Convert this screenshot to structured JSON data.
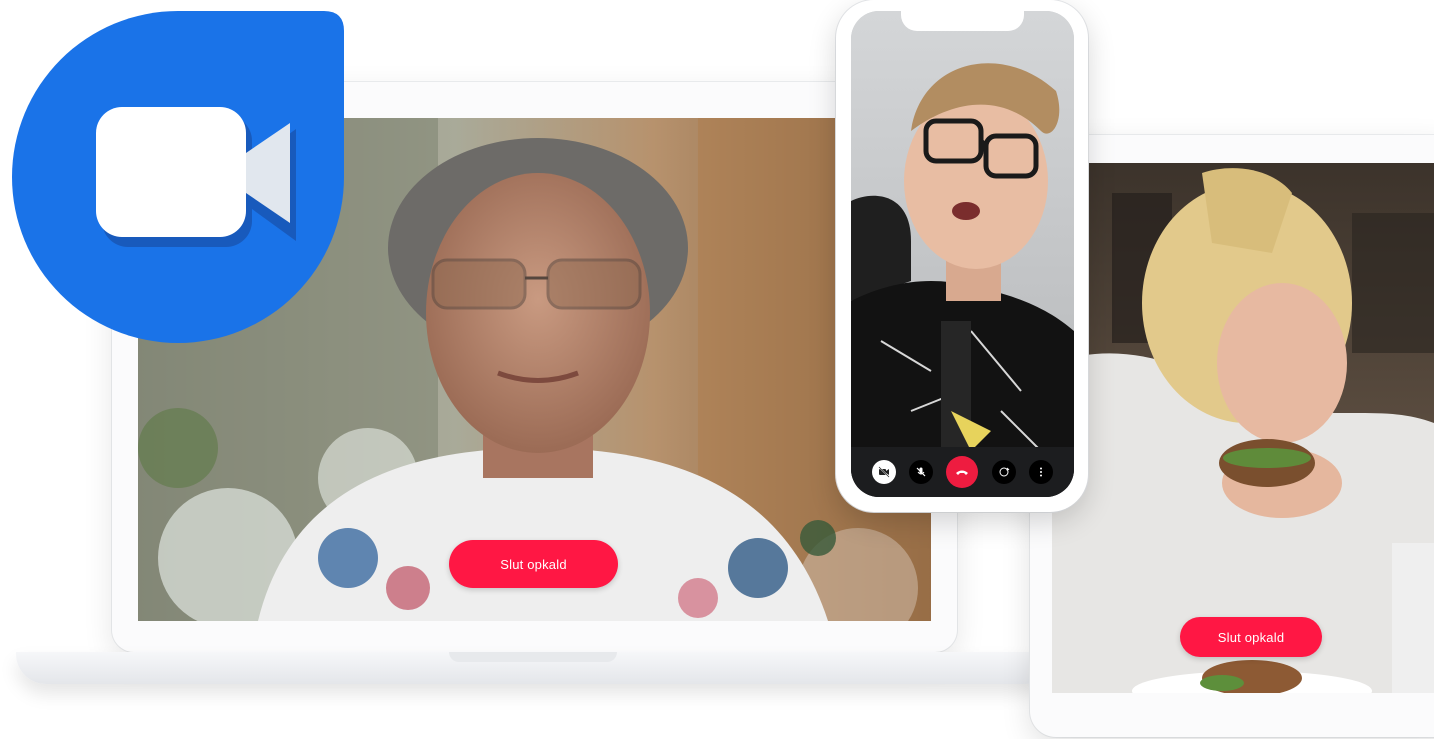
{
  "laptop": {
    "end_call_label": "Slut opkald"
  },
  "tablet": {
    "end_call_label": "Slut opkald"
  },
  "phone": {
    "controls": [
      "camera-off-icon",
      "mic-off-icon",
      "end-call-icon",
      "switch-camera-icon",
      "more-icon"
    ]
  },
  "logo": {
    "icon": "video-camera-icon"
  },
  "colors": {
    "brand_blue": "#1a73e8",
    "end_call_red": "#ff1744"
  }
}
